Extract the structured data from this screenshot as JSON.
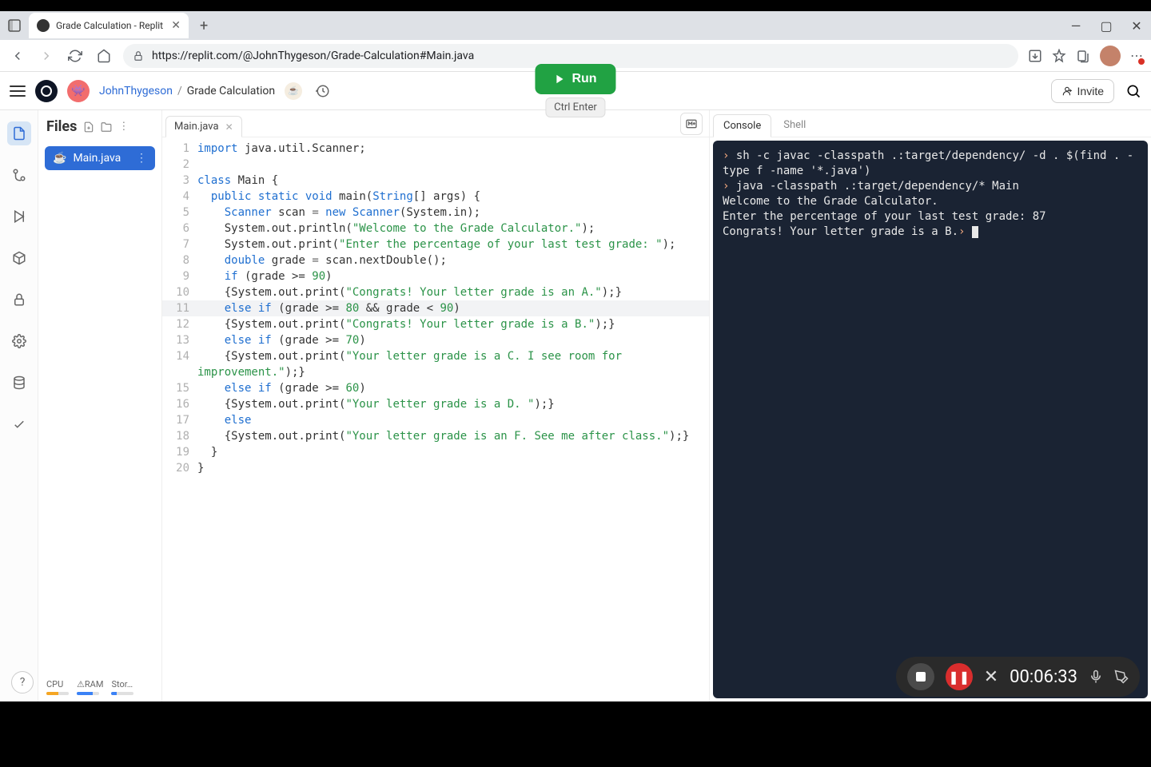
{
  "browser": {
    "tab_title": "Grade Calculation - Replit",
    "url": "https://replit.com/@JohnThygeson/Grade-Calculation#Main.java"
  },
  "header": {
    "username": "JohnThygeson",
    "separator": "/",
    "project": "Grade Calculation",
    "run_label": "Run",
    "run_hint": "Ctrl  Enter",
    "invite_label": "Invite"
  },
  "files": {
    "pane_title": "Files",
    "active_file": "Main.java"
  },
  "editor": {
    "tab_name": "Main.java",
    "line_numbers": [
      "1",
      "2",
      "3",
      "4",
      "5",
      "6",
      "7",
      "8",
      "9",
      "10",
      "11",
      "12",
      "13",
      "14",
      "15",
      "16",
      "17",
      "18",
      "19",
      "20"
    ]
  },
  "code": {
    "l1a": "import",
    "l1b": " java.util.Scanner;",
    "l3a": "class",
    "l3b": " Main {",
    "l4a": "  public",
    "l4b": " static",
    "l4c": " void",
    "l4d": " main(",
    "l4e": "String",
    "l4f": "[] args) {",
    "l5a": "    Scanner",
    "l5b": " scan ",
    "l5c": "=",
    "l5d": " new",
    "l5e": " Scanner",
    "l5f": "(System.in);",
    "l6a": "    System.out.println(",
    "l6b": "\"Welcome to the Grade Calculator.\"",
    "l6c": ");",
    "l7a": "    System.out.print(",
    "l7b": "\"Enter the percentage of your last test grade: \"",
    "l7c": ");",
    "l8a": "    double",
    "l8b": " grade ",
    "l8c": "=",
    "l8d": " scan.nextDouble();",
    "l9a": "    if",
    "l9b": " (grade >= ",
    "l9c": "90",
    "l9d": ")",
    "l10a": "    {System.out.print(",
    "l10b": "\"Congrats! Your letter grade is an A.\"",
    "l10c": ");}",
    "l11a": "    else",
    "l11b": " if",
    "l11c": " (grade >= ",
    "l11d": "80",
    "l11e": " && grade < ",
    "l11f": "90",
    "l11g": ")",
    "l12a": "    {System.out.print(",
    "l12b": "\"Congrats! Your letter grade is a B.\"",
    "l12c": ");}",
    "l13a": "    else",
    "l13b": " if",
    "l13c": " (grade >= ",
    "l13d": "70",
    "l13e": ")",
    "l14a": "    {System.out.print(",
    "l14b": "\"Your letter grade is a C. I see room for improvement.\"",
    "l14c": ");}",
    "l15a": "    else",
    "l15b": " if",
    "l15c": " (grade >= ",
    "l15d": "60",
    "l15e": ")",
    "l16a": "    {System.out.print(",
    "l16b": "\"Your letter grade is a D. \"",
    "l16c": ");}",
    "l17a": "    else",
    "l18a": "    {System.out.print(",
    "l18b": "\"Your letter grade is an F. See me after class.\"",
    "l18c": ");}",
    "l19a": "  }",
    "l20a": "}"
  },
  "console": {
    "tabs": {
      "console": "Console",
      "shell": "Shell"
    },
    "lines": {
      "l1": "sh -c javac -classpath .:target/dependency/ -d . $(find . -type f -name '*.java')",
      "l2": "java -classpath .:target/dependency/* Main",
      "l3": "Welcome to the Grade Calculator.",
      "l4": "Enter the percentage of your last test grade: 87",
      "l5": "Congrats! Your letter grade is a B."
    },
    "prompt_char": "›"
  },
  "resources": {
    "cpu": "CPU",
    "ram": "RAM",
    "storage": "Stor…"
  },
  "recorder": {
    "time": "00:06:33"
  }
}
